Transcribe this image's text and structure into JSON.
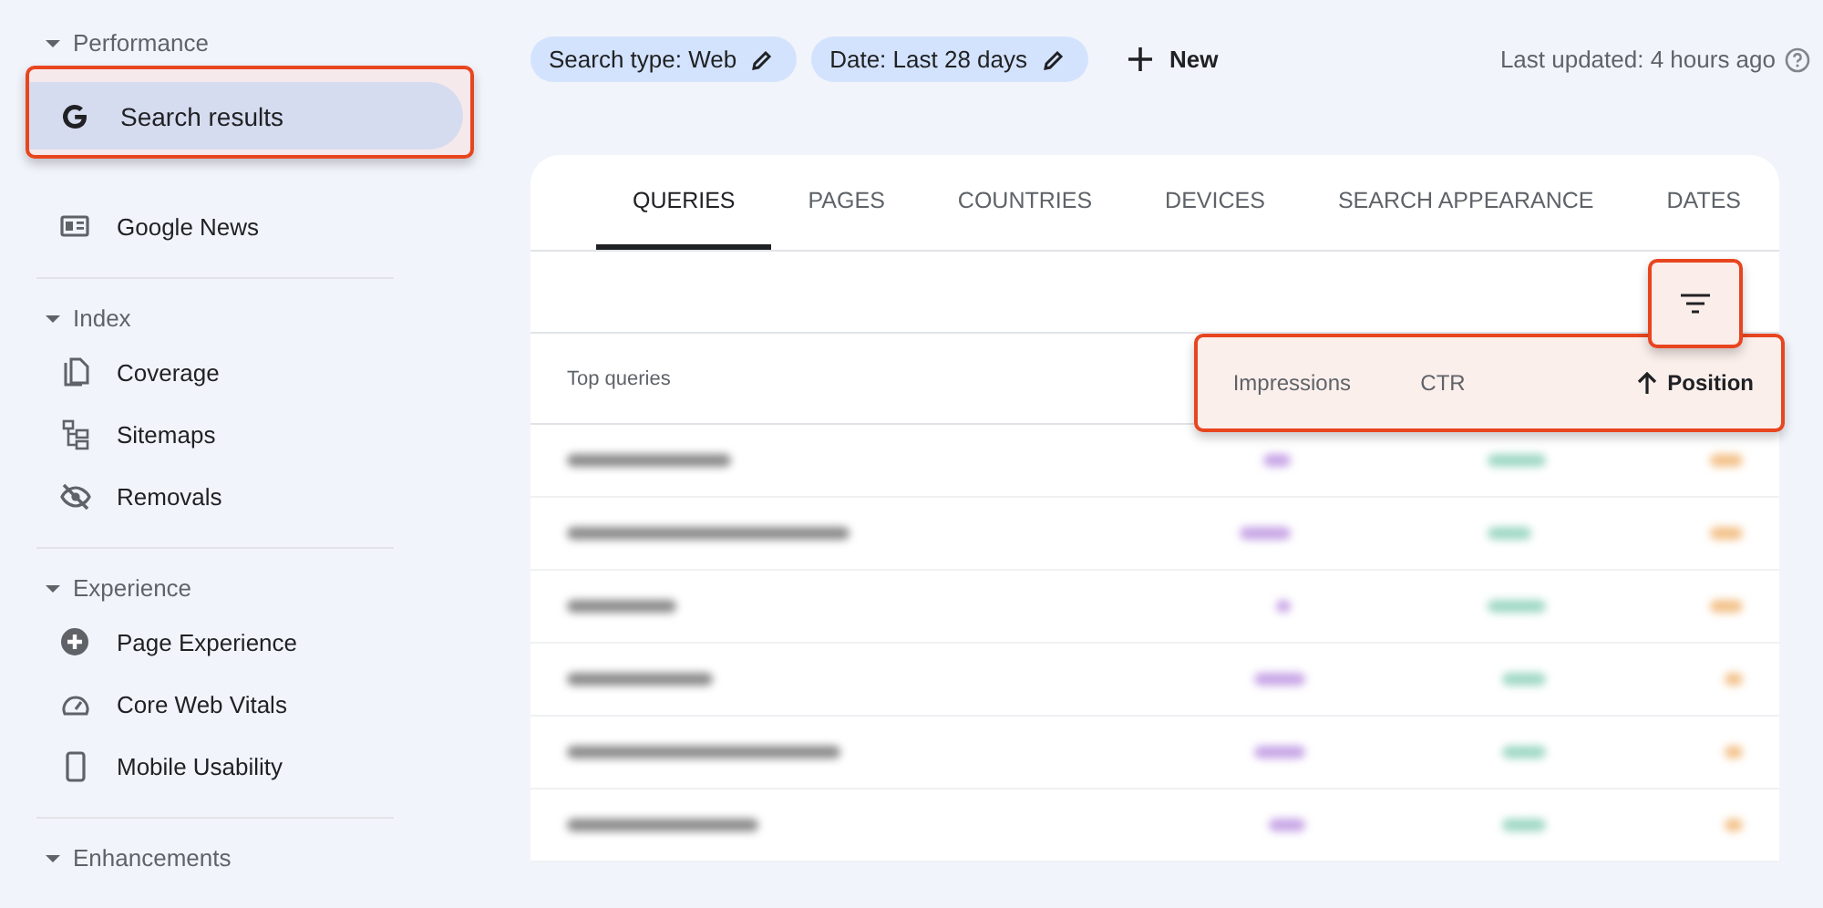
{
  "sidebar": {
    "sections": [
      {
        "title": "Performance",
        "expanded": true,
        "items": [
          {
            "label": "Search results",
            "selected": true,
            "highlighted": true
          },
          {
            "label": "Google News",
            "selected": false,
            "highlighted": false
          }
        ]
      },
      {
        "title": "Index",
        "expanded": true,
        "items": [
          {
            "label": "Coverage",
            "selected": false,
            "highlighted": false
          },
          {
            "label": "Sitemaps",
            "selected": false,
            "highlighted": false
          },
          {
            "label": "Removals",
            "selected": false,
            "highlighted": false
          }
        ]
      },
      {
        "title": "Experience",
        "expanded": true,
        "items": [
          {
            "label": "Page Experience",
            "selected": false,
            "highlighted": false
          },
          {
            "label": "Core Web Vitals",
            "selected": false,
            "highlighted": false
          },
          {
            "label": "Mobile Usability",
            "selected": false,
            "highlighted": false
          }
        ]
      },
      {
        "title": "Enhancements",
        "expanded": true
      }
    ]
  },
  "filters": [
    {
      "label": "Search type: Web"
    },
    {
      "label": "Date: Last 28 days"
    }
  ],
  "new_button": {
    "label": "New"
  },
  "last_updated": "Last updated: 4 hours ago",
  "tabs": [
    {
      "label": "QUERIES",
      "selected": true
    },
    {
      "label": "PAGES",
      "selected": false
    },
    {
      "label": "COUNTRIES",
      "selected": false
    },
    {
      "label": "DEVICES",
      "selected": false
    },
    {
      "label": "SEARCH APPEARANCE",
      "selected": false
    },
    {
      "label": "DATES",
      "selected": false
    }
  ],
  "filter_button": {
    "highlighted": true
  },
  "table": {
    "columns": [
      {
        "label": "Top queries",
        "sorted": false
      },
      {
        "label": "Impressions",
        "sorted": false
      },
      {
        "label": "CTR",
        "sorted": false
      },
      {
        "label": "Position",
        "sorted": true
      }
    ],
    "metric_columns_highlighted": true,
    "rows": [
      {
        "kind": "blurred"
      },
      {
        "kind": "blurred"
      },
      {
        "kind": "blurred"
      },
      {
        "kind": "blurred"
      },
      {
        "kind": "blurred"
      },
      {
        "kind": "blurred"
      }
    ]
  }
}
